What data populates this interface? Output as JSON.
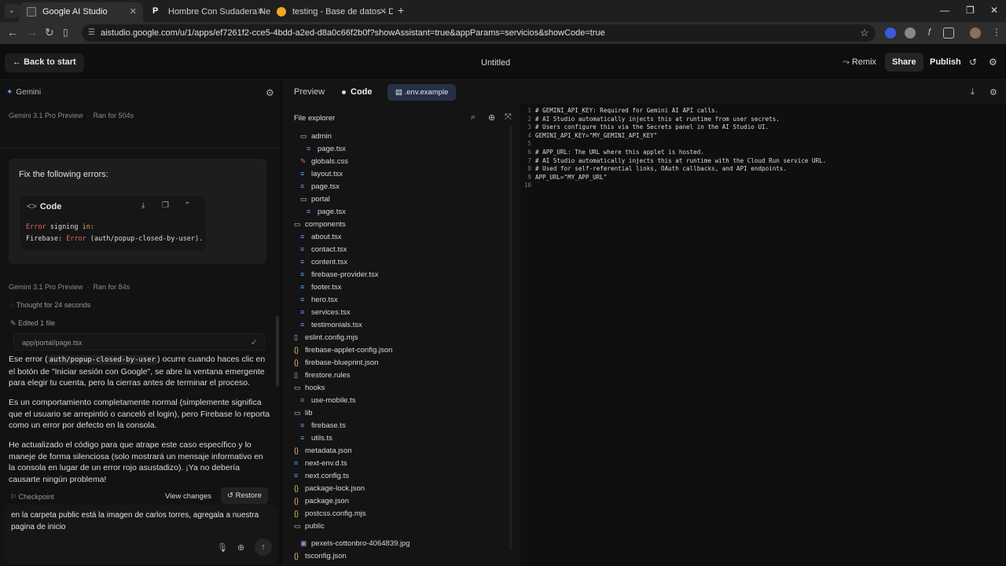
{
  "browser": {
    "tabs": [
      {
        "title": "Google AI Studio",
        "active": true
      },
      {
        "title": "Hombre Con Sudadera Negra Y",
        "active": false
      },
      {
        "title": "testing - Base de datos - Datos",
        "active": false
      }
    ],
    "url": "aistudio.google.com/u/1/apps/ef7261f2-cce5-4bdd-a2ed-d8a0c66f2b0f?showAssistant=true&appParams=servicios&showCode=true"
  },
  "header": {
    "back_label": "Back to start",
    "title": "Untitled",
    "remix_label": "Remix",
    "share_label": "Share",
    "publish_label": "Publish"
  },
  "chat": {
    "panel_title": "Gemini",
    "run1_model": "Gemini 3.1 Pro Preview",
    "run1_time": "Ran for 504s",
    "user_message": "Fix the following errors:",
    "code_card": {
      "title": "Code",
      "line1_a": "Error",
      "line1_b": " signing ",
      "line1_c": "in:",
      "line2_a": "Firebase: ",
      "line2_b": "Error",
      "line2_c": " (auth/popup-closed-by-user)."
    },
    "run2_model": "Gemini 3.1 Pro Preview",
    "run2_time": "Ran for 84s",
    "thought": "Thought for 24 seconds",
    "edited": "Edited 1 file",
    "edited_file": "app/portal/page.tsx",
    "para1_a": "Ese error (",
    "para1_code": "auth/popup-closed-by-user",
    "para1_b": ") ocurre cuando haces clic en el botón de \"Iniciar sesión con Google\", se abre la ventana emergente para elegir tu cuenta, pero la cierras antes de terminar el proceso.",
    "para2": "Es un comportamiento completamente normal (simplemente significa que el usuario se arrepintió o canceló el login), pero Firebase lo reporta como un error por defecto en la consola.",
    "para3": "He actualizado el código para que atrape este caso específico y lo maneje de forma silenciosa (solo mostrará un mensaje informativo en la consola en lugar de un error rojo asustadizo). ¡Ya no debería causarte ningún problema!",
    "checkpoint": "Checkpoint",
    "view_changes": "View changes",
    "restore": "Restore",
    "input_text": "en la carpeta public está la imagen de carlos torres, agregala a nuestra pagina de inicio"
  },
  "right": {
    "tab_preview": "Preview",
    "tab_code": "Code",
    "open_file": ".env.example",
    "explorer_title": "File explorer",
    "tree": [
      {
        "name": "admin",
        "type": "folder",
        "depth": 1
      },
      {
        "name": "page.tsx",
        "type": "ts",
        "depth": 2
      },
      {
        "name": "globals.css",
        "type": "css",
        "depth": 1
      },
      {
        "name": "layout.tsx",
        "type": "ts",
        "depth": 1
      },
      {
        "name": "page.tsx",
        "type": "ts",
        "depth": 1
      },
      {
        "name": "portal",
        "type": "folder",
        "depth": 1
      },
      {
        "name": "page.tsx",
        "type": "ts",
        "depth": 2
      },
      {
        "name": "components",
        "type": "folder",
        "depth": 0
      },
      {
        "name": "about.tsx",
        "type": "ts",
        "depth": 1
      },
      {
        "name": "contact.tsx",
        "type": "ts",
        "depth": 1
      },
      {
        "name": "content.tsx",
        "type": "ts",
        "depth": 1
      },
      {
        "name": "firebase-provider.tsx",
        "type": "ts",
        "depth": 1
      },
      {
        "name": "footer.tsx",
        "type": "ts",
        "depth": 1
      },
      {
        "name": "hero.tsx",
        "type": "ts",
        "depth": 1
      },
      {
        "name": "services.tsx",
        "type": "ts",
        "depth": 1
      },
      {
        "name": "testimonials.tsx",
        "type": "ts",
        "depth": 1
      },
      {
        "name": "eslint.config.mjs",
        "type": "file",
        "depth": 0
      },
      {
        "name": "firebase-applet-config.json",
        "type": "json",
        "depth": 0
      },
      {
        "name": "firebase-blueprint.json",
        "type": "json",
        "depth": 0
      },
      {
        "name": "firestore.rules",
        "type": "file",
        "depth": 0
      },
      {
        "name": "hooks",
        "type": "folder",
        "depth": 0
      },
      {
        "name": "use-mobile.ts",
        "type": "ts",
        "depth": 1
      },
      {
        "name": "lib",
        "type": "folder",
        "depth": 0
      },
      {
        "name": "firebase.ts",
        "type": "ts",
        "depth": 1
      },
      {
        "name": "utils.ts",
        "type": "ts",
        "depth": 1
      },
      {
        "name": "metadata.json",
        "type": "json",
        "depth": 0
      },
      {
        "name": "next-env.d.ts",
        "type": "ts",
        "depth": 0
      },
      {
        "name": "next.config.ts",
        "type": "ts",
        "depth": 0
      },
      {
        "name": "package-lock.json",
        "type": "json",
        "depth": 0
      },
      {
        "name": "package.json",
        "type": "json",
        "depth": 0
      },
      {
        "name": "postcss.config.mjs",
        "type": "json",
        "depth": 0
      },
      {
        "name": "public",
        "type": "folder",
        "depth": 0
      },
      {
        "name": "pexels-cottonbro-4064839.jpg",
        "type": "img",
        "depth": 1
      },
      {
        "name": "tsconfig.json",
        "type": "json",
        "depth": 0
      }
    ],
    "code_lines": [
      "# GEMINI_API_KEY: Required for Gemini AI API calls.",
      "# AI Studio automatically injects this at runtime from user secrets.",
      "# Users configure this via the Secrets panel in the AI Studio UI.",
      "GEMINI_API_KEY=\"MY_GEMINI_API_KEY\"",
      "",
      "# APP_URL: The URL where this applet is hosted.",
      "# AI Studio automatically injects this at runtime with the Cloud Run service URL.",
      "# Used for self-referential links, OAuth callbacks, and API endpoints.",
      "APP_URL=\"MY_APP_URL\"",
      ""
    ]
  },
  "colors": {
    "accent": "#8ab4f8",
    "env_tab_bg": "#263045",
    "error_red": "#e0685f",
    "success_green": "#4caf50"
  }
}
